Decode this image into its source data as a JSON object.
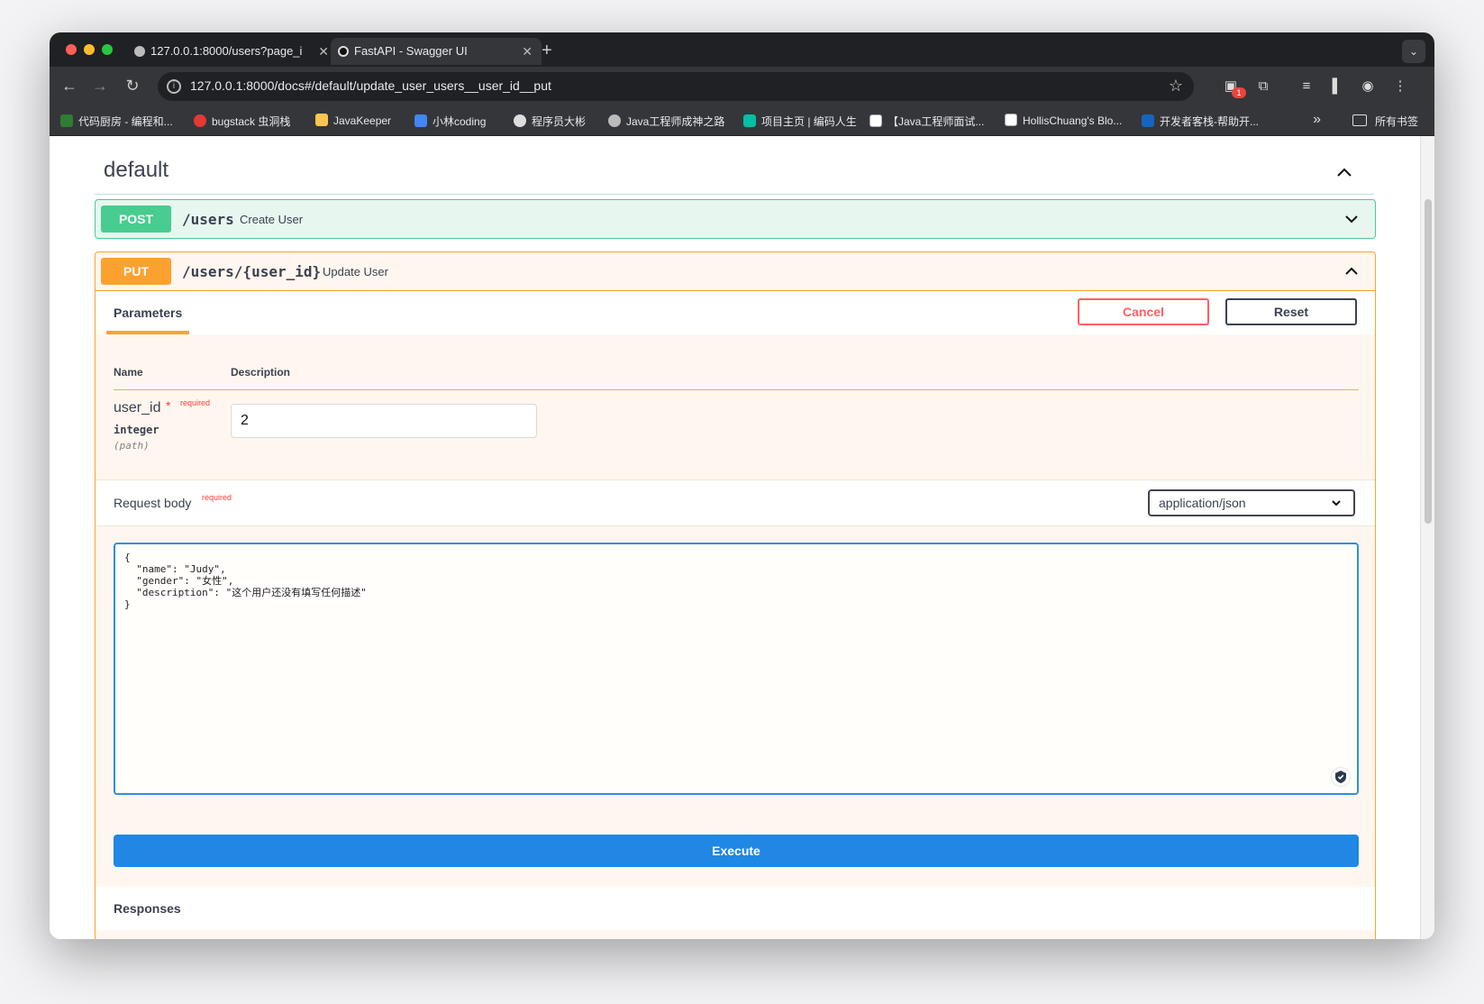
{
  "browser": {
    "tabs": [
      {
        "title": "127.0.0.1:8000/users?page_i",
        "active": false
      },
      {
        "title": "FastAPI - Swagger UI",
        "active": true
      }
    ],
    "new_tab_symbol": "+",
    "url": "127.0.0.1:8000/docs#/default/update_user_users__user_id__put",
    "extension_badge": "1",
    "bookmarks": [
      {
        "label": "代码厨房 - 编程和..."
      },
      {
        "label": "bugstack 虫洞栈"
      },
      {
        "label": "JavaKeeper"
      },
      {
        "label": "小林coding"
      },
      {
        "label": "程序员大彬"
      },
      {
        "label": "Java工程师成神之路"
      },
      {
        "label": "项目主页 | 编码人生"
      },
      {
        "label": "【Java工程师面试..."
      },
      {
        "label": "HollisChuang's Blo..."
      },
      {
        "label": "开发者客栈-帮助开..."
      }
    ],
    "bookmarks_more": "»",
    "all_bookmarks": "所有书签"
  },
  "swagger": {
    "section_title": "default",
    "operations": [
      {
        "method": "POST",
        "path": "/users",
        "summary": "Create User"
      },
      {
        "method": "PUT",
        "path": "/users/{user_id}",
        "summary": "Update User"
      }
    ],
    "parameters_tab": "Parameters",
    "cancel_label": "Cancel",
    "reset_label": "Reset",
    "table_headers": {
      "name": "Name",
      "description": "Description"
    },
    "param": {
      "name": "user_id",
      "star": "*",
      "required_label": "required",
      "type": "integer",
      "in": "(path)",
      "value": "2"
    },
    "request_body": {
      "label": "Request body",
      "required_label": "required",
      "content_type": "application/json",
      "code": "{\n  \"name\": \"Judy\",\n  \"gender\": \"女性\",\n  \"description\": \"这个用户还没有填写任何描述\"\n}"
    },
    "execute_label": "Execute",
    "responses_label": "Responses"
  },
  "colors": {
    "post": "#49cc90",
    "put": "#fca130",
    "execute": "#2087e4",
    "cancel": "#ff6060"
  }
}
